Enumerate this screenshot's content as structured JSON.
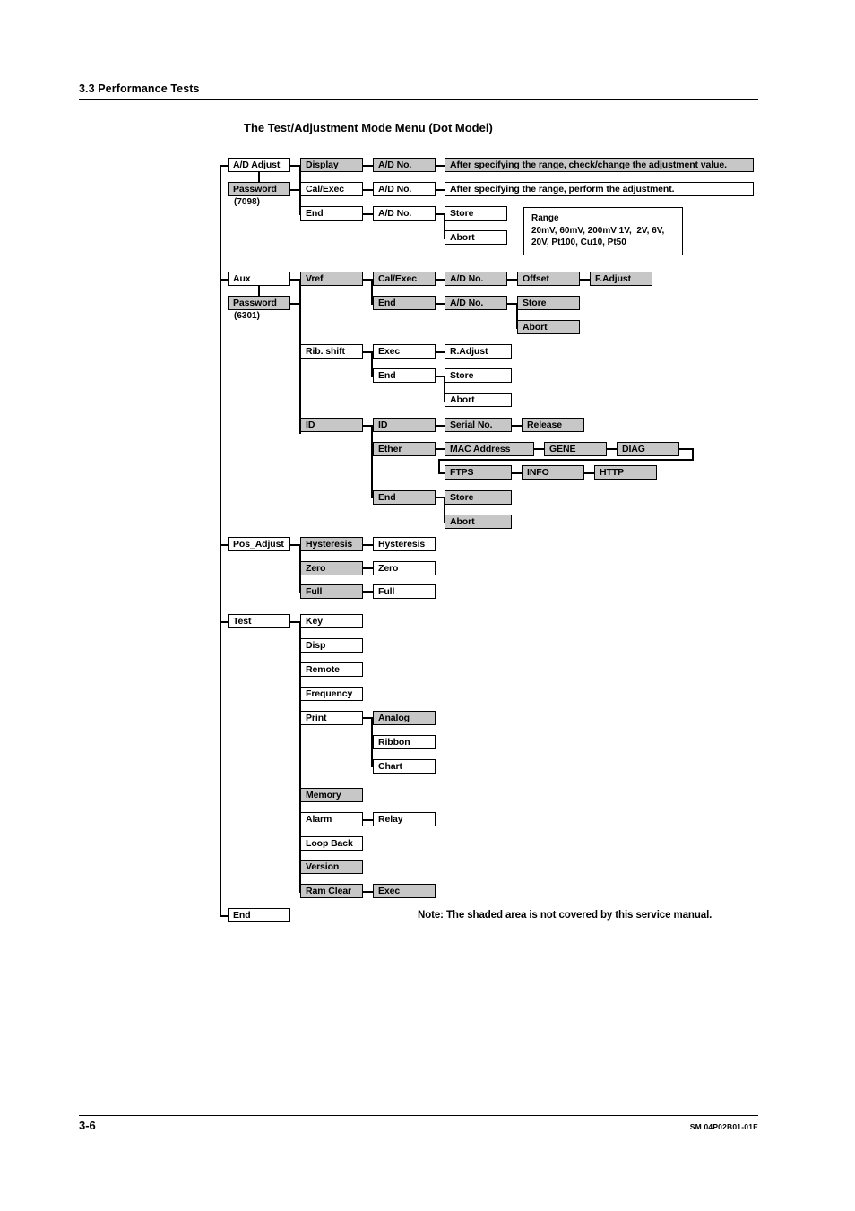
{
  "page": {
    "section_title": "3.3  Performance Tests",
    "diagram_title": "The Test/Adjustment Mode Menu (Dot Model)",
    "page_number": "3-6",
    "doc_code": "SM 04P02B01-01E",
    "note": "Note: The shaded area is not covered by this service manual."
  },
  "legend": {
    "shaded_color": "#c7c7c7",
    "plain_color": "#ffffff",
    "line_color": "#000000"
  },
  "range_callout": {
    "title": "Range",
    "line1": "20mV, 60mV, 200mV 1V,  2V, 6V,",
    "line2": "20V, Pt100, Cu10, Pt50",
    "text": "Range\n20mV, 60mV, 200mV 1V,  2V, 6V,\n20V, Pt100, Cu10, Pt50"
  },
  "nodes": {
    "ad_adjust": {
      "label": "A/D Adjust",
      "shaded": false
    },
    "ad_password": {
      "label": "Password",
      "shaded": true
    },
    "ad_password_value": {
      "label": "(7098)"
    },
    "ad_display": {
      "label": "Display",
      "shaded": true
    },
    "ad_display_adno": {
      "label": "A/D No.",
      "shaded": true
    },
    "ad_display_desc": {
      "label": "After specifying the range, check/change the adjustment value.",
      "shaded": true
    },
    "ad_calexec": {
      "label": "Cal/Exec",
      "shaded": false
    },
    "ad_calexec_adno": {
      "label": "A/D No.",
      "shaded": false
    },
    "ad_calexec_desc": {
      "label": "After specifying the range, perform the adjustment.",
      "shaded": false
    },
    "ad_end": {
      "label": "End",
      "shaded": false
    },
    "ad_end_adno": {
      "label": "A/D No.",
      "shaded": false
    },
    "ad_end_store": {
      "label": "Store",
      "shaded": false
    },
    "ad_end_abort": {
      "label": "Abort",
      "shaded": false
    },
    "aux": {
      "label": "Aux",
      "shaded": false
    },
    "aux_password": {
      "label": "Password",
      "shaded": true
    },
    "aux_password_value": {
      "label": "(6301)"
    },
    "aux_vref": {
      "label": "Vref",
      "shaded": true
    },
    "vref_calexec": {
      "label": "Cal/Exec",
      "shaded": true
    },
    "vref_calexec_adno": {
      "label": "A/D No.",
      "shaded": true
    },
    "vref_offset": {
      "label": "Offset",
      "shaded": true
    },
    "vref_fadjust": {
      "label": "F.Adjust",
      "shaded": true
    },
    "vref_end": {
      "label": "End",
      "shaded": true
    },
    "vref_end_adno": {
      "label": "A/D No.",
      "shaded": true
    },
    "vref_store": {
      "label": "Store",
      "shaded": true
    },
    "vref_abort": {
      "label": "Abort",
      "shaded": true
    },
    "rib_shift": {
      "label": "Rib. shift",
      "shaded": false
    },
    "rib_exec": {
      "label": "Exec",
      "shaded": false
    },
    "rib_radjust": {
      "label": "R.Adjust",
      "shaded": false
    },
    "rib_end": {
      "label": "End",
      "shaded": false
    },
    "rib_store": {
      "label": "Store",
      "shaded": false
    },
    "rib_abort": {
      "label": "Abort",
      "shaded": false
    },
    "id": {
      "label": "ID",
      "shaded": true
    },
    "id_id": {
      "label": "ID",
      "shaded": true
    },
    "id_serialno": {
      "label": "Serial No.",
      "shaded": true
    },
    "id_release": {
      "label": "Release",
      "shaded": true
    },
    "id_ether": {
      "label": "Ether",
      "shaded": true
    },
    "id_mac": {
      "label": "MAC Address",
      "shaded": true
    },
    "id_gene": {
      "label": "GENE",
      "shaded": true
    },
    "id_diag": {
      "label": "DIAG",
      "shaded": true
    },
    "id_ftps": {
      "label": "FTPS",
      "shaded": true
    },
    "id_info": {
      "label": "INFO",
      "shaded": true
    },
    "id_http": {
      "label": "HTTP",
      "shaded": true
    },
    "id_end": {
      "label": "End",
      "shaded": true
    },
    "id_store": {
      "label": "Store",
      "shaded": true
    },
    "id_abort": {
      "label": "Abort",
      "shaded": true
    },
    "pos_adjust": {
      "label": "Pos_Adjust",
      "shaded": false
    },
    "pos_hysteresis": {
      "label": "Hysteresis",
      "shaded": true
    },
    "pos_hysteresis2": {
      "label": "Hysteresis",
      "shaded": false
    },
    "pos_zero": {
      "label": "Zero",
      "shaded": true
    },
    "pos_zero2": {
      "label": "Zero",
      "shaded": false
    },
    "pos_full": {
      "label": "Full",
      "shaded": true
    },
    "pos_full2": {
      "label": "Full",
      "shaded": false
    },
    "test": {
      "label": "Test",
      "shaded": false
    },
    "test_key": {
      "label": "Key",
      "shaded": false
    },
    "test_disp": {
      "label": "Disp",
      "shaded": false
    },
    "test_remote": {
      "label": "Remote",
      "shaded": false
    },
    "test_frequency": {
      "label": "Frequency",
      "shaded": false
    },
    "test_print": {
      "label": "Print",
      "shaded": false
    },
    "test_analog": {
      "label": "Analog",
      "shaded": true
    },
    "test_ribbon": {
      "label": "Ribbon",
      "shaded": false
    },
    "test_chart": {
      "label": "Chart",
      "shaded": false
    },
    "test_memory": {
      "label": "Memory",
      "shaded": true
    },
    "test_alarm": {
      "label": "Alarm",
      "shaded": false
    },
    "test_relay": {
      "label": "Relay",
      "shaded": false
    },
    "test_loopback": {
      "label": "Loop Back",
      "shaded": false
    },
    "test_version": {
      "label": "Version",
      "shaded": true
    },
    "test_ramclear": {
      "label": "Ram Clear",
      "shaded": true
    },
    "test_exec": {
      "label": "Exec",
      "shaded": true
    },
    "root_end": {
      "label": "End",
      "shaded": false
    }
  }
}
